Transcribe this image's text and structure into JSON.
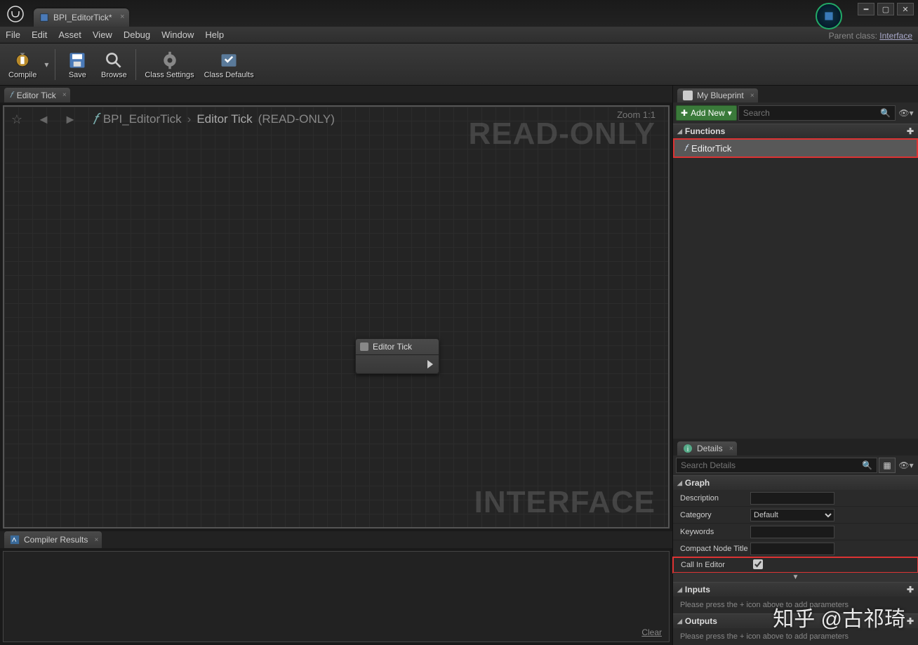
{
  "window": {
    "tab_title": "BPI_EditorTick*",
    "parent_label": "Parent class:",
    "parent_value": "Interface"
  },
  "menu": {
    "file": "File",
    "edit": "Edit",
    "asset": "Asset",
    "view": "View",
    "debug": "Debug",
    "window": "Window",
    "help": "Help"
  },
  "toolbar": {
    "compile": "Compile",
    "save": "Save",
    "browse": "Browse",
    "class_settings": "Class Settings",
    "class_defaults": "Class Defaults"
  },
  "graph_tab": {
    "title": "Editor Tick"
  },
  "breadcrumb": {
    "root": "BPI_EditorTick",
    "func": "Editor Tick",
    "status": "(READ-ONLY)",
    "zoom": "Zoom 1:1"
  },
  "watermark": {
    "top": "READ-ONLY",
    "bottom": "INTERFACE"
  },
  "node": {
    "title": "Editor Tick"
  },
  "compiler": {
    "tab": "Compiler Results",
    "clear": "Clear"
  },
  "my_blueprint": {
    "tab": "My Blueprint",
    "add_new": "Add New",
    "search_placeholder": "Search",
    "functions_header": "Functions",
    "function_item": "EditorTick"
  },
  "details": {
    "tab": "Details",
    "search_placeholder": "Search Details",
    "graph_header": "Graph",
    "description_label": "Description",
    "description_value": "",
    "category_label": "Category",
    "category_value": "Default",
    "keywords_label": "Keywords",
    "keywords_value": "",
    "compact_label": "Compact Node Title",
    "compact_value": "",
    "call_editor_label": "Call In Editor",
    "inputs_header": "Inputs",
    "inputs_hint": "Please press the + icon above to add parameters",
    "outputs_header": "Outputs",
    "outputs_hint": "Please press the + icon above to add parameters"
  },
  "credit": "知乎 @古祁琦"
}
